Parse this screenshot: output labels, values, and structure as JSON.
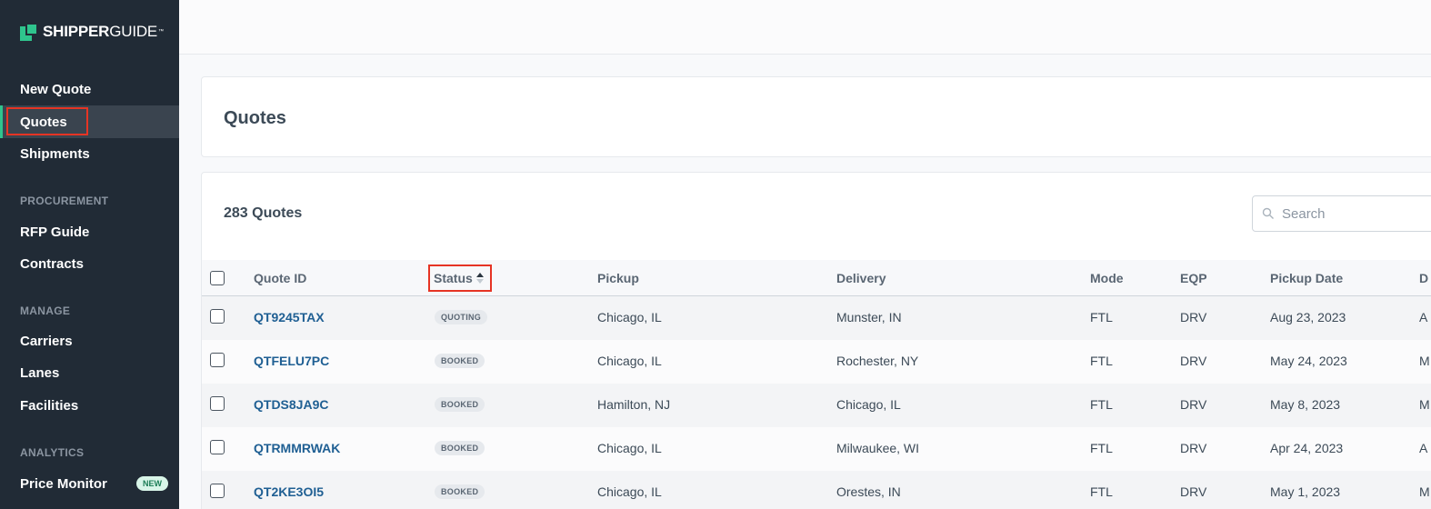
{
  "logo": {
    "bold": "SHIPPER",
    "thin": "GUIDE",
    "tm": "™"
  },
  "sidebar": {
    "new_quote": "New Quote",
    "quotes": "Quotes",
    "shipments": "Shipments",
    "procurement_head": "PROCUREMENT",
    "rfp_guide": "RFP Guide",
    "contracts": "Contracts",
    "manage_head": "MANAGE",
    "carriers": "Carriers",
    "lanes": "Lanes",
    "facilities": "Facilities",
    "analytics_head": "ANALYTICS",
    "price_monitor": "Price Monitor",
    "new_badge": "NEW"
  },
  "page": {
    "title": "Quotes"
  },
  "table": {
    "count": "283 Quotes",
    "search_placeholder": "Search",
    "headers": {
      "quote_id": "Quote ID",
      "status": "Status",
      "pickup": "Pickup",
      "delivery": "Delivery",
      "mode": "Mode",
      "eqp": "EQP",
      "pickup_date": "Pickup Date",
      "next_col": "D"
    },
    "rows": [
      {
        "id": "QT9245TAX",
        "status": "QUOTING",
        "pickup": "Chicago, IL",
        "delivery": "Munster, IN",
        "mode": "FTL",
        "eqp": "DRV",
        "date": "Aug 23, 2023",
        "next": "A"
      },
      {
        "id": "QTFELU7PC",
        "status": "BOOKED",
        "pickup": "Chicago, IL",
        "delivery": "Rochester, NY",
        "mode": "FTL",
        "eqp": "DRV",
        "date": "May 24, 2023",
        "next": "M"
      },
      {
        "id": "QTDS8JA9C",
        "status": "BOOKED",
        "pickup": "Hamilton, NJ",
        "delivery": "Chicago, IL",
        "mode": "FTL",
        "eqp": "DRV",
        "date": "May 8, 2023",
        "next": "M"
      },
      {
        "id": "QTRMMRWAK",
        "status": "BOOKED",
        "pickup": "Chicago, IL",
        "delivery": "Milwaukee, WI",
        "mode": "FTL",
        "eqp": "DRV",
        "date": "Apr 24, 2023",
        "next": "A"
      },
      {
        "id": "QT2KE3OI5",
        "status": "BOOKED",
        "pickup": "Chicago, IL",
        "delivery": "Orestes, IN",
        "mode": "FTL",
        "eqp": "DRV",
        "date": "May 1, 2023",
        "next": "M"
      }
    ]
  },
  "colors": {
    "sidebar_bg": "#212b36",
    "accent": "#2fc48d",
    "link": "#1f5f93",
    "highlight": "#e63424"
  }
}
